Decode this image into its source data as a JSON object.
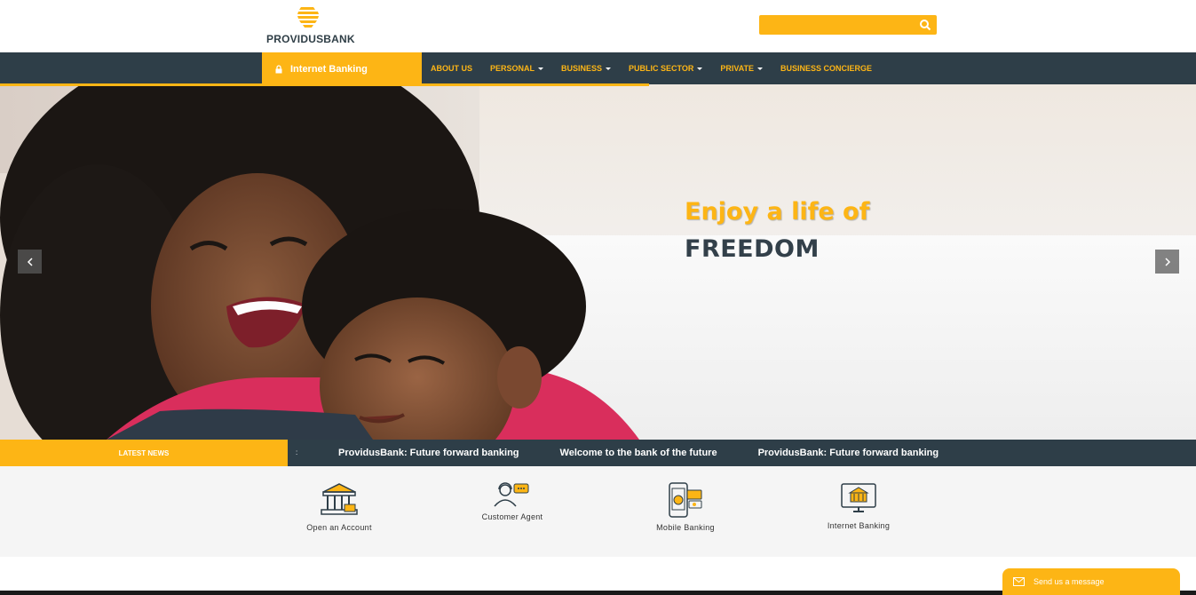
{
  "header": {
    "logo_text": "PROVIDUSBANK",
    "search": {
      "placeholder": ""
    }
  },
  "nav": {
    "internet_banking": "Internet Banking",
    "items": [
      {
        "label": "ABOUT US",
        "dropdown": false
      },
      {
        "label": "PERSONAL",
        "dropdown": true
      },
      {
        "label": "BUSINESS",
        "dropdown": true
      },
      {
        "label": "PUBLIC SECTOR",
        "dropdown": true
      },
      {
        "label": "PRIVATE",
        "dropdown": true
      },
      {
        "label": "BUSINESS CONCIERGE",
        "dropdown": false
      }
    ]
  },
  "hero": {
    "headline": "Enjoy a life of",
    "subheadline": "FREEDOM"
  },
  "news": {
    "label": "LATEST NEWS",
    "separator": ":",
    "items": [
      "ProvidusBank: Future forward banking",
      "Welcome to the bank of the future",
      "ProvidusBank: Future forward banking"
    ]
  },
  "quick_links": [
    {
      "label": "Open an Account",
      "icon": "bank-building-icon"
    },
    {
      "label": "Customer Agent",
      "icon": "customer-agent-icon"
    },
    {
      "label": "Mobile Banking",
      "icon": "mobile-banking-icon"
    },
    {
      "label": "Internet Banking",
      "icon": "monitor-bank-icon"
    }
  ],
  "chat": {
    "label": "Send us a message"
  },
  "colors": {
    "brand_yellow": "#fdb515",
    "nav_dark": "#2e3e48",
    "text_dark": "#33404a"
  }
}
